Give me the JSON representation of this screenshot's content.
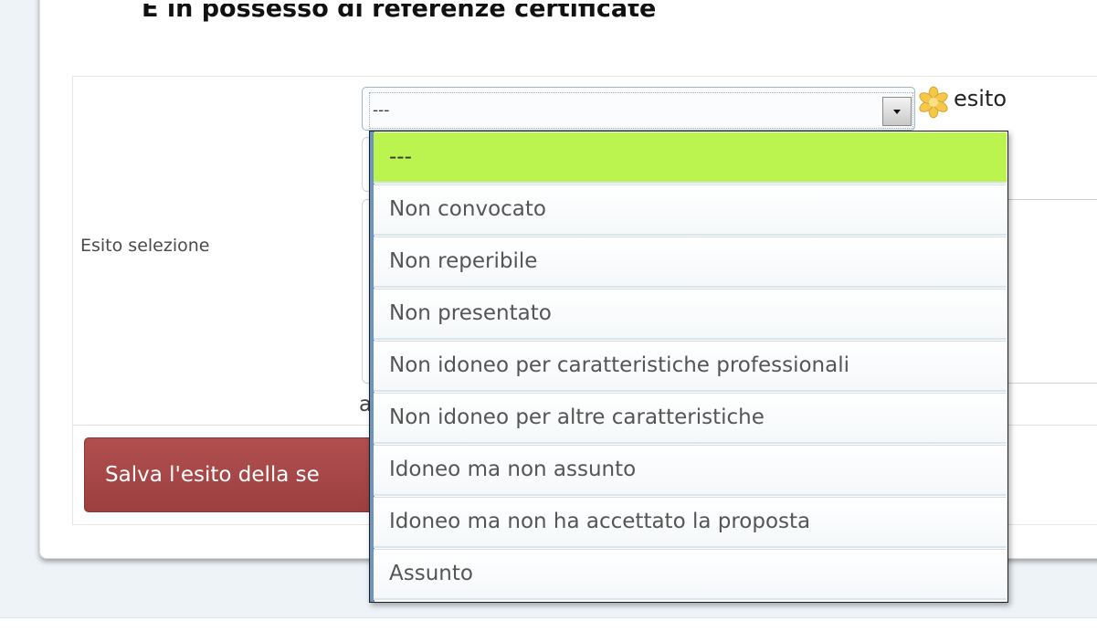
{
  "page": {
    "heading": "E in possesso di referenze certificate"
  },
  "form": {
    "field_label": "Esito selezione",
    "select": {
      "current_value": "---",
      "field_name": "esito"
    },
    "partial_text": "a",
    "save_button_label": "Salva l'esito della se"
  },
  "dropdown": {
    "options": [
      {
        "label": "---",
        "selected": true
      },
      {
        "label": "Non convocato"
      },
      {
        "label": "Non reperibile"
      },
      {
        "label": "Non presentato"
      },
      {
        "label": "Non idoneo per caratteristiche professionali"
      },
      {
        "label": "Non idoneo per altre caratteristiche"
      },
      {
        "label": "Idoneo ma non assunto"
      },
      {
        "label": "Idoneo ma non ha accettato la proposta"
      },
      {
        "label": "Assunto"
      }
    ]
  },
  "colors": {
    "selected_option": "#bcf44f",
    "save_button": "#a34545",
    "required_icon": "#f5c84a"
  },
  "icons": {
    "select_arrow": "chevron-down-icon",
    "required": "asterisk-icon"
  }
}
